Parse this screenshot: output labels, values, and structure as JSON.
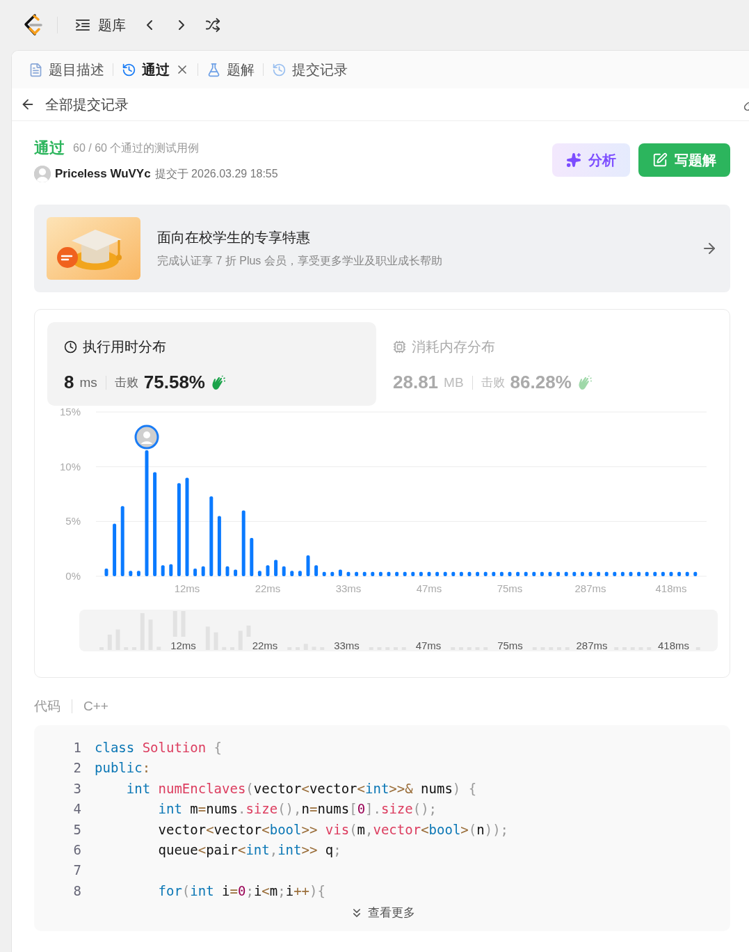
{
  "topbar": {
    "title": "题库"
  },
  "tabs": [
    {
      "label": "题目描述",
      "selected": false,
      "closable": false
    },
    {
      "label": "通过",
      "selected": true,
      "closable": true
    },
    {
      "label": "题解",
      "selected": false,
      "closable": false
    },
    {
      "label": "提交记录",
      "selected": false,
      "closable": false
    }
  ],
  "back": {
    "label": "全部提交记录"
  },
  "submission": {
    "status": "通过",
    "cases": "60 / 60 个通过的测试用例",
    "user": "Priceless WuVYc",
    "submitted": "提交于 2026.03.29 18:55"
  },
  "actions": [
    {
      "label": "分析",
      "kind": "analyze"
    },
    {
      "label": "写题解",
      "kind": "write"
    }
  ],
  "promo": {
    "kind": "picture",
    "title": "面向在校学生的专享特惠",
    "subtitle": "完成认证享 7 折 Plus 会员，享受更多学业及职业成长帮助"
  },
  "stats": [
    {
      "title": "执行用时分布",
      "value": "8",
      "unit": "ms",
      "beat_label": "击败",
      "beat": "75.58%",
      "selected": true
    },
    {
      "title": "消耗内存分布",
      "value": "28.81",
      "unit": "MB",
      "beat_label": "击败",
      "beat": "86.28%",
      "selected": false
    }
  ],
  "chart_data": {
    "type": "bar",
    "yticks": [
      {
        "value": 0,
        "label": "0%"
      },
      {
        "value": 5,
        "label": "5%"
      },
      {
        "value": 10,
        "label": "10%"
      },
      {
        "value": 15,
        "label": "15%"
      }
    ],
    "ylim": [
      0,
      15
    ],
    "categories": [
      null,
      null,
      null,
      null,
      null,
      null,
      null,
      null,
      null,
      null,
      "12ms",
      null,
      null,
      null,
      null,
      null,
      null,
      null,
      null,
      null,
      "22ms",
      null,
      null,
      null,
      null,
      null,
      null,
      null,
      null,
      null,
      "33ms",
      null,
      null,
      null,
      null,
      null,
      null,
      null,
      null,
      null,
      "47ms",
      null,
      null,
      null,
      null,
      null,
      null,
      null,
      null,
      null,
      "75ms",
      null,
      null,
      null,
      null,
      null,
      null,
      null,
      null,
      null,
      "287ms",
      null,
      null,
      null,
      null,
      null,
      null,
      null,
      null,
      null,
      "418ms",
      null,
      null,
      null
    ],
    "series": [
      {
        "color": "#0a7aff",
        "values": [
          0.7,
          4.8,
          6.4,
          0.5,
          0.5,
          11.5,
          9.5,
          1.0,
          1.1,
          8.5,
          9.0,
          0.7,
          0.9,
          7.3,
          5.5,
          0.9,
          0.6,
          6.0,
          3.5,
          0.5,
          1.0,
          1.5,
          0.9,
          0.5,
          0.5,
          1.9,
          1.0,
          0.4,
          0.4,
          0.6,
          0.4,
          0.4,
          0.4,
          0.4,
          0.4,
          0.4,
          0.4,
          0.4,
          0.4,
          0.4,
          0.4,
          0.4,
          0.4,
          0.4,
          0.4,
          0.4,
          0.4,
          0.4,
          0.4,
          0.4,
          0.4,
          0.4,
          0.4,
          0.4,
          0.4,
          0.4,
          0.4,
          0.4,
          0.4,
          0.4,
          0.4,
          0.4,
          0.4,
          0.4,
          0.4,
          0.4,
          0.4,
          0.4,
          0.4,
          0.4,
          0.4,
          0.4,
          0.4,
          0.4
        ]
      }
    ]
  },
  "overview": {
    "labels": [
      "12ms",
      "22ms",
      "33ms",
      "47ms",
      "75ms",
      "287ms",
      "418ms"
    ]
  },
  "code": {
    "label": "代码",
    "language": "C++",
    "more": "查看更多",
    "lines": [
      {
        "number": "1",
        "tokens": [
          {
            "t": "class",
            "kind": "kw"
          },
          {
            "t": " Solution",
            "kind": "fn"
          },
          {
            "t": " {",
            "kind": "punc"
          }
        ]
      },
      {
        "number": "2",
        "tokens": [
          {
            "t": "public",
            "kind": "kw"
          },
          {
            "t": ":",
            "kind": "op"
          }
        ]
      },
      {
        "number": "3",
        "tokens": [
          {
            "t": "    int",
            "kind": "kw"
          },
          {
            "t": " numEnclaves",
            "kind": "fn"
          },
          {
            "t": "(",
            "kind": "punc"
          },
          {
            "t": "vector",
            "kind": "plain"
          },
          {
            "t": "<",
            "kind": "op"
          },
          {
            "t": "vector",
            "kind": "plain"
          },
          {
            "t": "<",
            "kind": "op"
          },
          {
            "t": "int",
            "kind": "kw"
          },
          {
            "t": ">>&",
            "kind": "op"
          },
          {
            "t": " nums",
            "kind": "plain"
          },
          {
            "t": ")",
            "kind": "punc"
          },
          {
            "t": " {",
            "kind": "punc"
          }
        ]
      },
      {
        "number": "4",
        "tokens": [
          {
            "t": "        int",
            "kind": "kw"
          },
          {
            "t": " m",
            "kind": "plain"
          },
          {
            "t": "=",
            "kind": "op"
          },
          {
            "t": "nums",
            "kind": "plain"
          },
          {
            "t": ".",
            "kind": "punc"
          },
          {
            "t": "size",
            "kind": "fn"
          },
          {
            "t": "(),",
            "kind": "punc"
          },
          {
            "t": "n",
            "kind": "plain"
          },
          {
            "t": "=",
            "kind": "op"
          },
          {
            "t": "nums",
            "kind": "plain"
          },
          {
            "t": "[",
            "kind": "punc"
          },
          {
            "t": "0",
            "kind": "num"
          },
          {
            "t": "].",
            "kind": "punc"
          },
          {
            "t": "size",
            "kind": "fn"
          },
          {
            "t": "();",
            "kind": "punc"
          }
        ]
      },
      {
        "number": "5",
        "tokens": [
          {
            "t": "        vector",
            "kind": "plain"
          },
          {
            "t": "<",
            "kind": "op"
          },
          {
            "t": "vector",
            "kind": "plain"
          },
          {
            "t": "<",
            "kind": "op"
          },
          {
            "t": "bool",
            "kind": "kw"
          },
          {
            "t": ">>",
            "kind": "op"
          },
          {
            "t": " vis",
            "kind": "fn"
          },
          {
            "t": "(",
            "kind": "punc"
          },
          {
            "t": "m",
            "kind": "plain"
          },
          {
            "t": ",",
            "kind": "punc"
          },
          {
            "t": "vector",
            "kind": "fn"
          },
          {
            "t": "<",
            "kind": "op"
          },
          {
            "t": "bool",
            "kind": "kw"
          },
          {
            "t": ">",
            "kind": "op"
          },
          {
            "t": "(",
            "kind": "punc"
          },
          {
            "t": "n",
            "kind": "plain"
          },
          {
            "t": "));",
            "kind": "punc"
          }
        ]
      },
      {
        "number": "6",
        "tokens": [
          {
            "t": "        queue",
            "kind": "plain"
          },
          {
            "t": "<",
            "kind": "op"
          },
          {
            "t": "pair",
            "kind": "plain"
          },
          {
            "t": "<",
            "kind": "op"
          },
          {
            "t": "int",
            "kind": "kw"
          },
          {
            "t": ",",
            "kind": "punc"
          },
          {
            "t": "int",
            "kind": "kw"
          },
          {
            "t": ">>",
            "kind": "op"
          },
          {
            "t": " q",
            "kind": "plain"
          },
          {
            "t": ";",
            "kind": "punc"
          }
        ]
      },
      {
        "number": "7"
      },
      {
        "number": "8",
        "tokens": [
          {
            "t": "        for",
            "kind": "kw"
          },
          {
            "t": "(",
            "kind": "punc"
          },
          {
            "t": "int",
            "kind": "kw"
          },
          {
            "t": " i",
            "kind": "plain"
          },
          {
            "t": "=",
            "kind": "op"
          },
          {
            "t": "0",
            "kind": "num"
          },
          {
            "t": ";",
            "kind": "punc"
          },
          {
            "t": "i",
            "kind": "plain"
          },
          {
            "t": "<",
            "kind": "op"
          },
          {
            "t": "m",
            "kind": "plain"
          },
          {
            "t": ";",
            "kind": "punc"
          },
          {
            "t": "i",
            "kind": "plain"
          },
          {
            "t": "++",
            "kind": "op"
          },
          {
            "t": ")",
            "kind": "punc"
          },
          {
            "t": "{",
            "kind": "punc"
          }
        ]
      }
    ]
  }
}
